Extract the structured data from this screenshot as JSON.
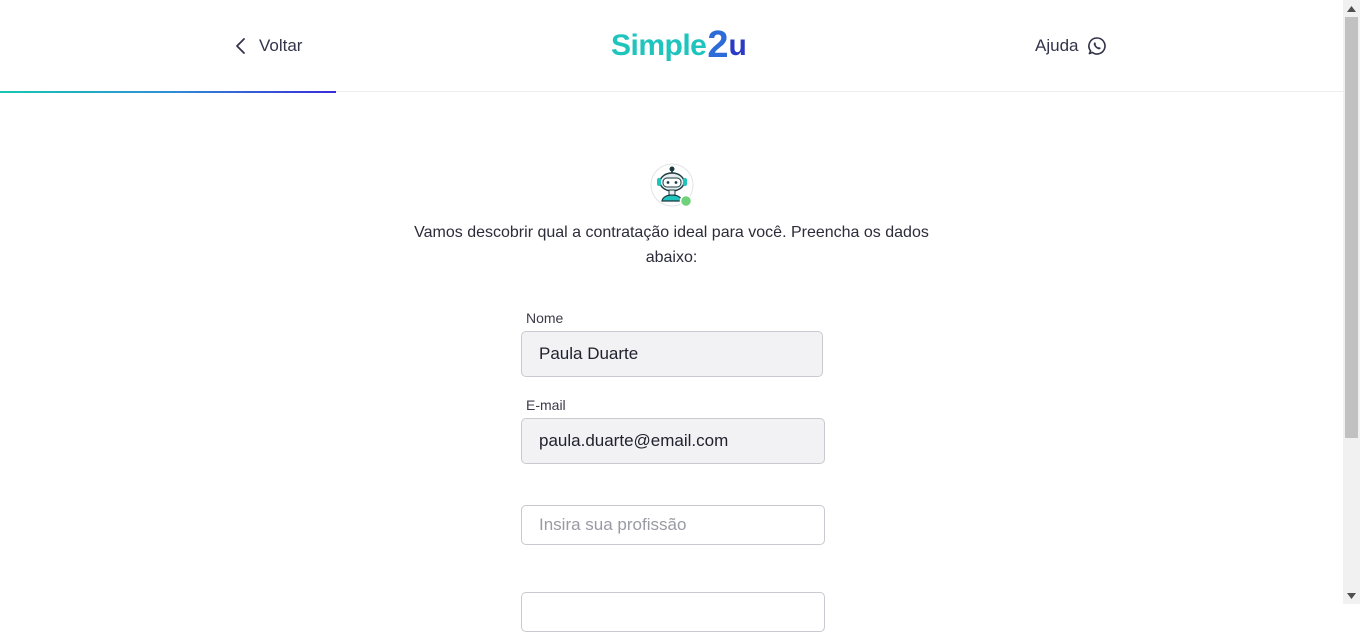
{
  "header": {
    "back_label": "Voltar",
    "logo": {
      "text": "Simple",
      "two": "2",
      "u": "u"
    },
    "help_label": "Ajuda",
    "progress_fraction": 0.25
  },
  "intro": {
    "text": "Vamos descobrir qual a contratação ideal para você. Preencha os dados abaixo:"
  },
  "form": {
    "name": {
      "label": "Nome",
      "value": "Paula Duarte"
    },
    "email": {
      "label": "E-mail",
      "value": "paula.duarte@email.com"
    },
    "profession": {
      "placeholder": "Insira sua profissão"
    }
  },
  "colors": {
    "accent_teal": "#1fc4bd",
    "accent_blue": "#2b3bc4"
  }
}
